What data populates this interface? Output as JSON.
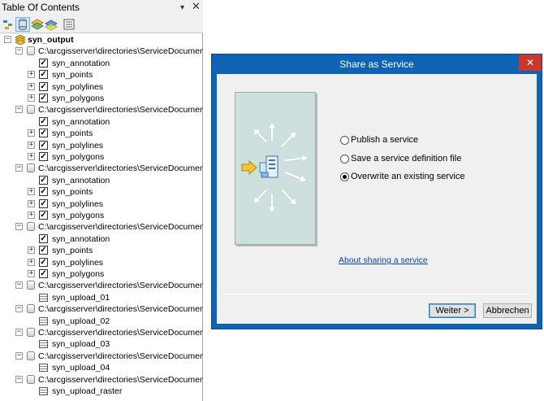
{
  "toc": {
    "title": "Table Of Contents",
    "pin_icon": "pin-icon",
    "close_icon": "close-icon",
    "toolbar": [
      "list-by-drawing-order-icon",
      "list-by-source-icon",
      "list-by-visibility-icon",
      "list-by-selection-icon",
      "options-icon"
    ],
    "root": "syn_output",
    "groups": [
      {
        "path": "C:\\arcgisserver\\directories\\ServiceDocuments\\",
        "layers": [
          {
            "name": "syn_annotation",
            "expandable": false,
            "checked": true
          },
          {
            "name": "syn_points",
            "expandable": true,
            "checked": true
          },
          {
            "name": "syn_polylines",
            "expandable": true,
            "checked": true
          },
          {
            "name": "syn_polygons",
            "expandable": true,
            "checked": true
          }
        ]
      },
      {
        "path": "C:\\arcgisserver\\directories\\ServiceDocuments\\",
        "layers": [
          {
            "name": "syn_annotation",
            "expandable": false,
            "checked": true
          },
          {
            "name": "syn_points",
            "expandable": true,
            "checked": true
          },
          {
            "name": "syn_polylines",
            "expandable": true,
            "checked": true
          },
          {
            "name": "syn_polygons",
            "expandable": true,
            "checked": true
          }
        ]
      },
      {
        "path": "C:\\arcgisserver\\directories\\ServiceDocuments\\",
        "layers": [
          {
            "name": "syn_annotation",
            "expandable": false,
            "checked": true
          },
          {
            "name": "syn_points",
            "expandable": true,
            "checked": true
          },
          {
            "name": "syn_polylines",
            "expandable": true,
            "checked": true
          },
          {
            "name": "syn_polygons",
            "expandable": true,
            "checked": true
          }
        ]
      },
      {
        "path": "C:\\arcgisserver\\directories\\ServiceDocuments\\",
        "layers": [
          {
            "name": "syn_annotation",
            "expandable": false,
            "checked": true
          },
          {
            "name": "syn_points",
            "expandable": true,
            "checked": true
          },
          {
            "name": "syn_polylines",
            "expandable": true,
            "checked": true
          },
          {
            "name": "syn_polygons",
            "expandable": true,
            "checked": true
          }
        ]
      },
      {
        "path": "C:\\arcgisserver\\directories\\ServiceDocuments\\",
        "tables": [
          "syn_upload_01"
        ]
      },
      {
        "path": "C:\\arcgisserver\\directories\\ServiceDocuments\\",
        "tables": [
          "syn_upload_02"
        ]
      },
      {
        "path": "C:\\arcgisserver\\directories\\ServiceDocuments\\",
        "tables": [
          "syn_upload_03"
        ]
      },
      {
        "path": "C:\\arcgisserver\\directories\\ServiceDocuments\\",
        "tables": [
          "syn_upload_04"
        ]
      },
      {
        "path": "C:\\arcgisserver\\directories\\ServiceDocuments\\",
        "tables": [
          "syn_upload_raster"
        ]
      }
    ]
  },
  "dialog": {
    "title": "Share as Service",
    "close_icon": "close-icon",
    "illustration_icon": "share-service-arrows-icon",
    "options": [
      {
        "label": "Publish a service",
        "selected": false
      },
      {
        "label": "Save a service definition file",
        "selected": false
      },
      {
        "label": "Overwrite an existing service",
        "selected": true
      }
    ],
    "link": "About sharing a service",
    "next_label": "Weiter >",
    "cancel_label": "Abbrechen"
  },
  "colors": {
    "title_bar": "#0f63b4",
    "close_button": "#c8392b",
    "link": "#0645ad",
    "illustration_bg": "#cde0de"
  }
}
